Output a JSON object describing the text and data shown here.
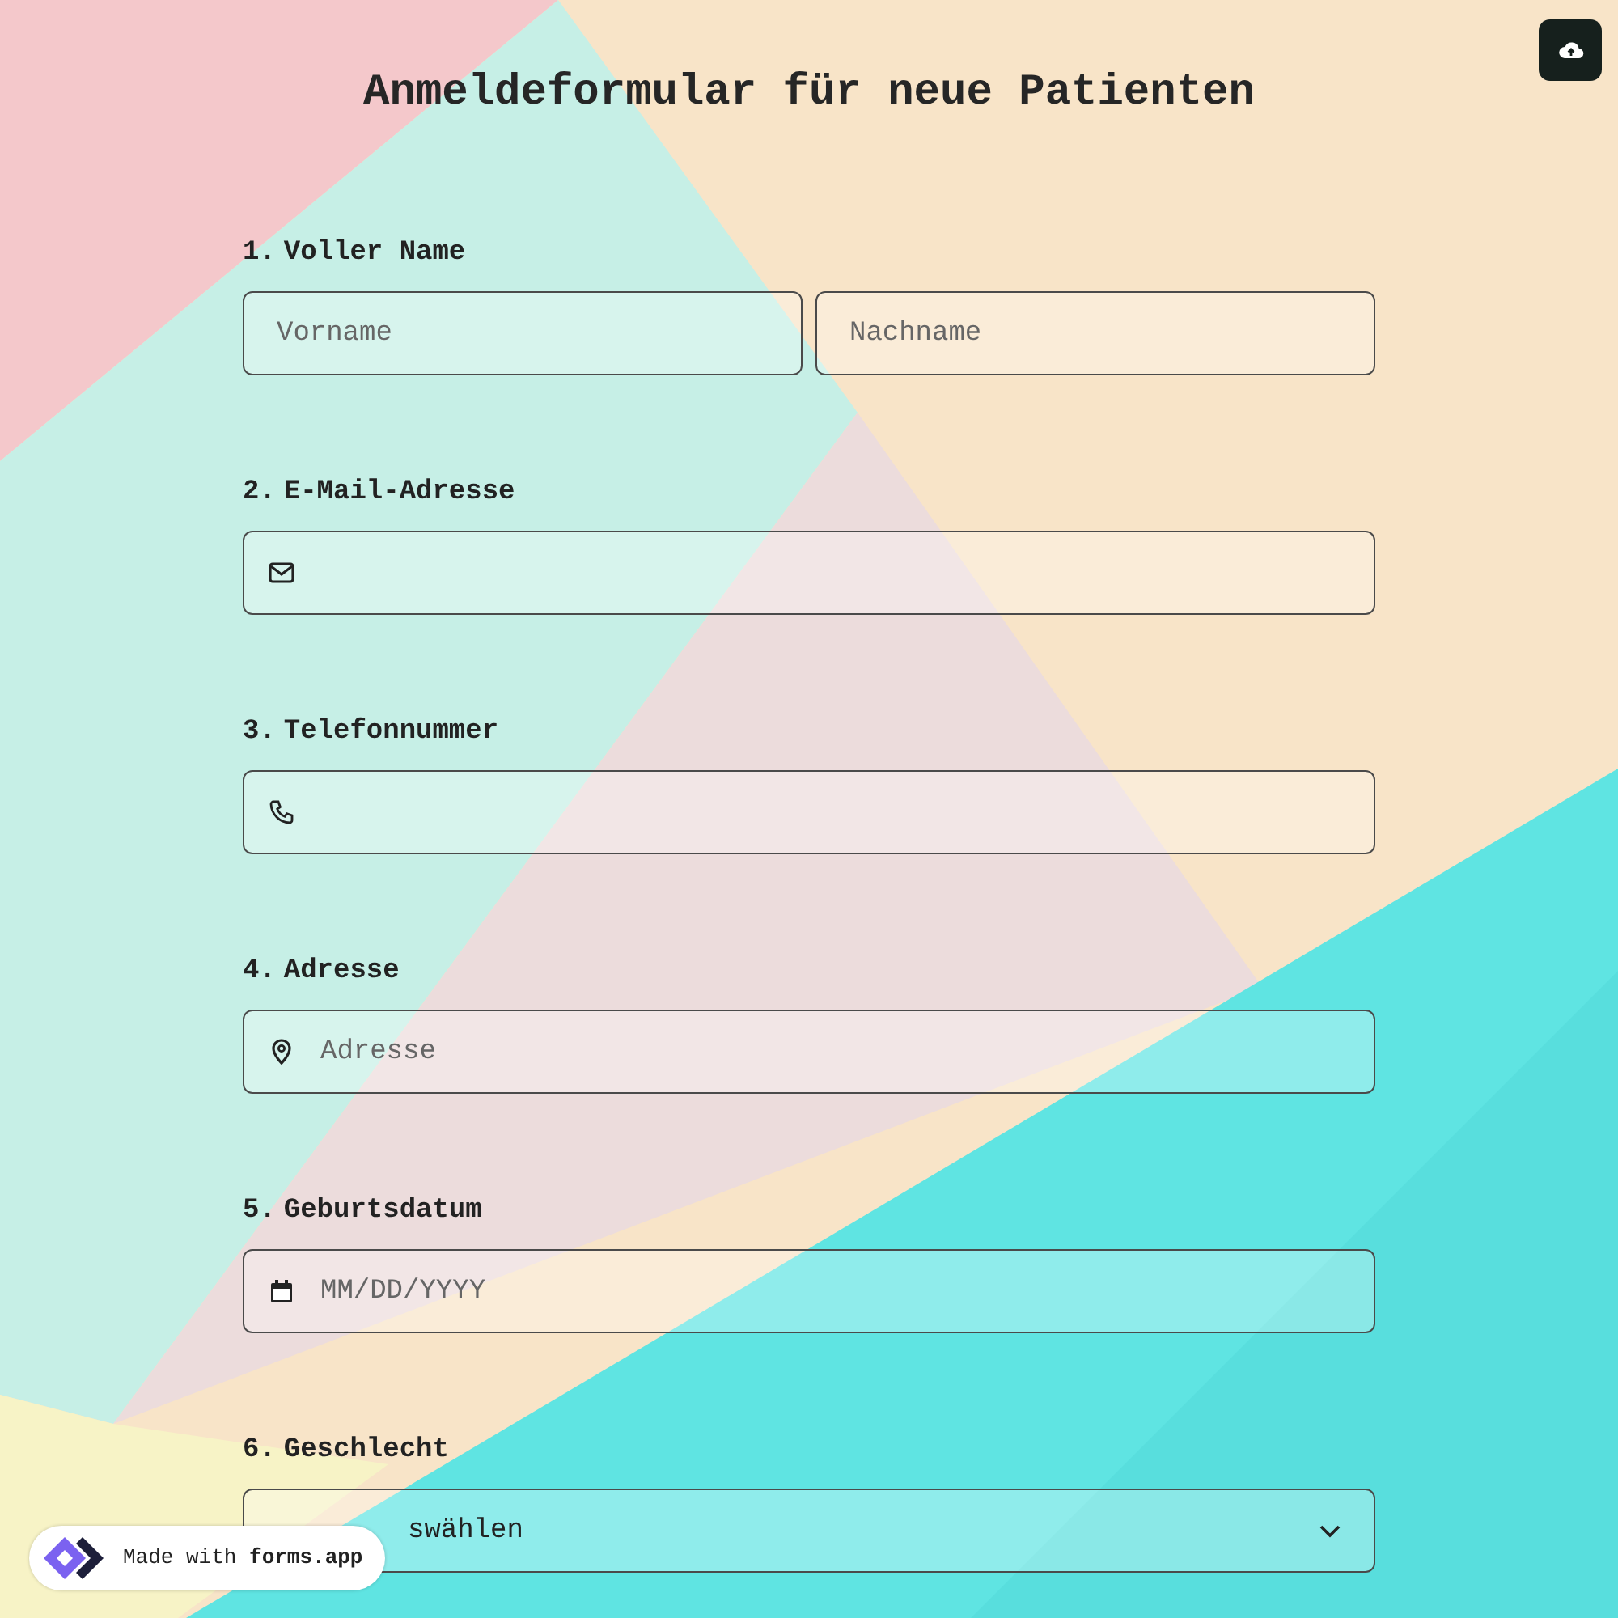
{
  "title": "Anmeldeformular für neue Patienten",
  "questions": [
    {
      "number": "1.",
      "label": "Voller Name",
      "kind": "name",
      "fields": [
        {
          "placeholder": "Vorname"
        },
        {
          "placeholder": "Nachname"
        }
      ]
    },
    {
      "number": "2.",
      "label": "E-Mail-Adresse",
      "kind": "email"
    },
    {
      "number": "3.",
      "label": "Telefonnummer",
      "kind": "phone"
    },
    {
      "number": "4.",
      "label": "Adresse",
      "kind": "address",
      "fields": [
        {
          "placeholder": "Adresse"
        }
      ]
    },
    {
      "number": "5.",
      "label": "Geburtsdatum",
      "kind": "date",
      "fields": [
        {
          "placeholder": "MM/DD/YYYY"
        }
      ]
    },
    {
      "number": "6.",
      "label": "Geschlecht",
      "kind": "select",
      "fields": [
        {
          "value": "swählen"
        }
      ]
    }
  ],
  "badge": {
    "text": "Made with **forms.app**"
  }
}
